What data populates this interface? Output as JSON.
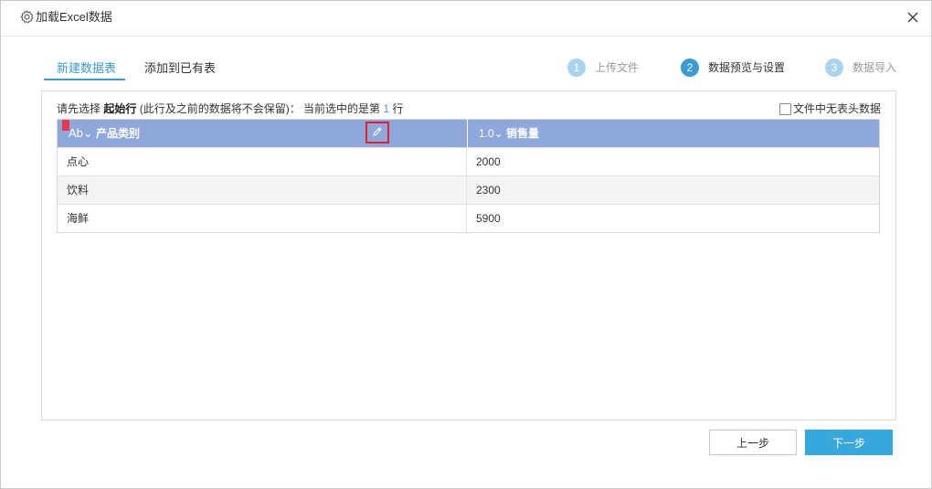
{
  "window": {
    "title": "加载Excel数据"
  },
  "tabs": [
    {
      "label": "新建数据表",
      "active": true
    },
    {
      "label": "添加到已有表",
      "active": false
    }
  ],
  "steps": [
    {
      "number": "1",
      "label": "上传文件",
      "active": false
    },
    {
      "number": "2",
      "label": "数据预览与设置",
      "active": true
    },
    {
      "number": "3",
      "label": "数据导入",
      "active": false
    }
  ],
  "hint": {
    "prefix": "请先选择",
    "bold": "起始行",
    "middle": "(此行及之前的数据将不会保留)：  当前选中的是第",
    "row": "1",
    "suffix": "行"
  },
  "no_header_label": "文件中无表头数据",
  "table": {
    "columns": [
      {
        "type": "Ab⌄",
        "name": "产品类别"
      },
      {
        "type": "1.0⌄",
        "name": "销售量"
      }
    ],
    "rows": [
      [
        "点心",
        "2000"
      ],
      [
        "饮料",
        "2300"
      ],
      [
        "海鲜",
        "5900"
      ]
    ]
  },
  "buttons": {
    "prev": "上一步",
    "next": "下一步"
  },
  "colors": {
    "accent": "#3a9bd5",
    "header_bg": "#8fa8dc",
    "step_active": "#3a9bd5",
    "step_inactive": "#a9d4ee",
    "primary_button": "#37a8db"
  }
}
